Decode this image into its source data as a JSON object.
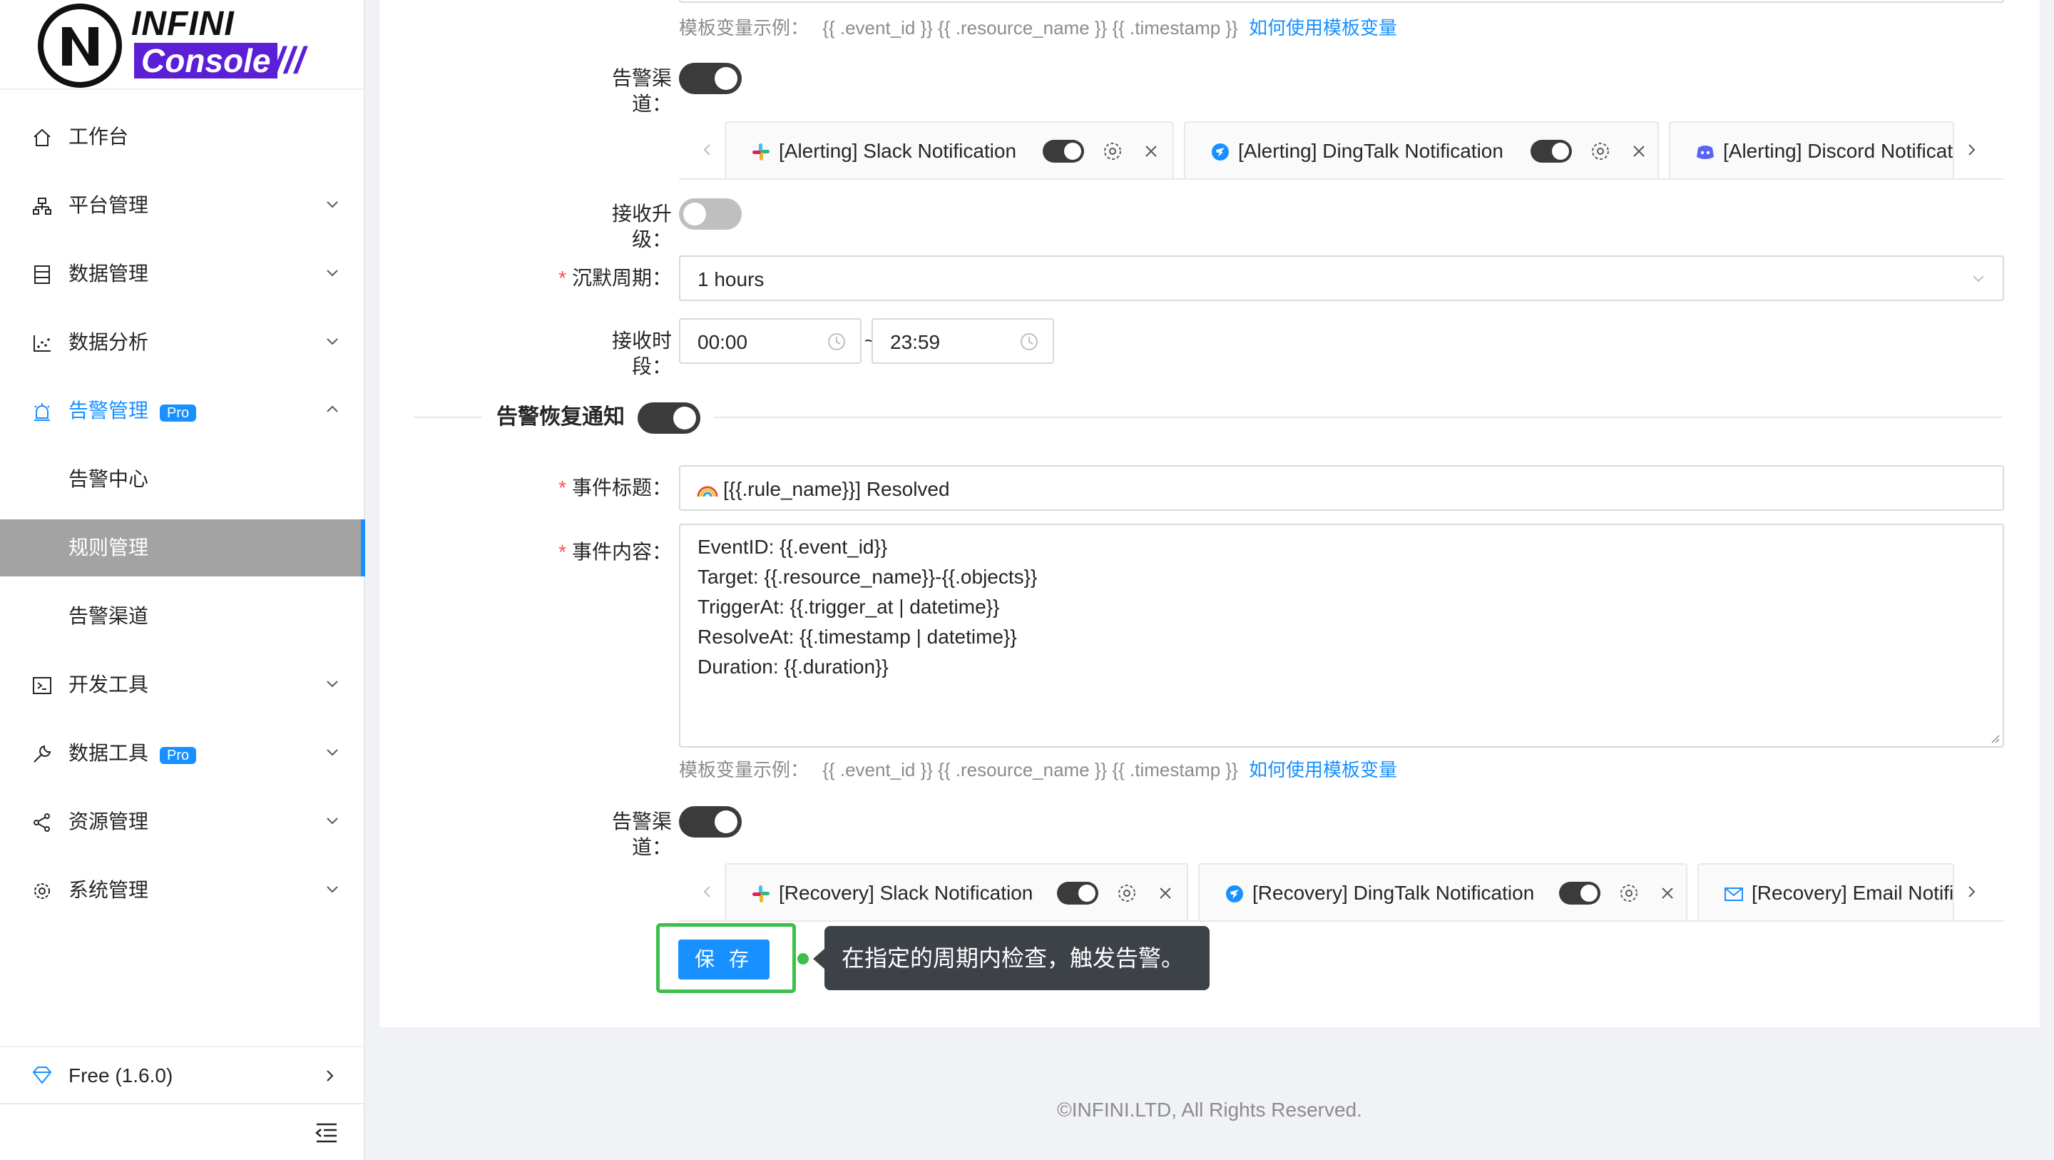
{
  "brand": {
    "top": "INFINI",
    "bottom": "Console",
    "slashes": "///"
  },
  "sidebar": {
    "items": [
      {
        "label": "工作台",
        "icon": "home-icon"
      },
      {
        "label": "平台管理",
        "icon": "cluster-icon"
      },
      {
        "label": "数据管理",
        "icon": "database-icon"
      },
      {
        "label": "数据分析",
        "icon": "chart-icon"
      },
      {
        "label": "告警管理",
        "icon": "alarm-icon",
        "badge": "Pro"
      },
      {
        "label": "开发工具",
        "icon": "terminal-icon"
      },
      {
        "label": "数据工具",
        "icon": "tool-icon",
        "badge": "Pro"
      },
      {
        "label": "资源管理",
        "icon": "share-icon"
      },
      {
        "label": "系统管理",
        "icon": "settings-icon"
      }
    ],
    "submenu": [
      "告警中心",
      "规则管理",
      "告警渠道"
    ],
    "version": "Free (1.6.0)"
  },
  "form": {
    "hint_prefix": "模板变量示例：",
    "hint_vars": "{{ .event_id }} {{ .resource_name }} {{ .timestamp }}",
    "hint_link": "如何使用模板变量",
    "channel_label": "告警渠道：",
    "escalation_label": "接收升级：",
    "silence_label": "沉默周期：",
    "silence_value": "1 hours",
    "time_label": "接收时段：",
    "time_start": "00:00",
    "time_sep": "~",
    "time_end": "23:59",
    "recovery_title": "告警恢复通知",
    "event_title_label": "事件标题：",
    "event_title_value": "[{{.rule_name}}] Resolved",
    "event_content_label": "事件内容：",
    "event_content_lines": [
      "EventID: {{.event_id}}",
      "Target: {{.resource_name}}-{{.objects}}",
      "TriggerAt: {{.trigger_at | datetime}}",
      "ResolveAt: {{.timestamp | datetime}}",
      "Duration: {{.duration}}"
    ],
    "alert_tabs": [
      "[Alerting] Slack Notification",
      "[Alerting] DingTalk Notification",
      "[Alerting] Discord Notification"
    ],
    "recovery_tabs": [
      "[Recovery] Slack Notification",
      "[Recovery] DingTalk Notification",
      "[Recovery] Email Notification"
    ],
    "save_label": "保 存",
    "tooltip": "在指定的周期内检查，触发告警。"
  },
  "colors": {
    "primary": "#1890ff",
    "brand": "#5b1fd6",
    "highlight": "#3cc04a"
  },
  "footer": "©INFINI.LTD, All Rights Reserved."
}
